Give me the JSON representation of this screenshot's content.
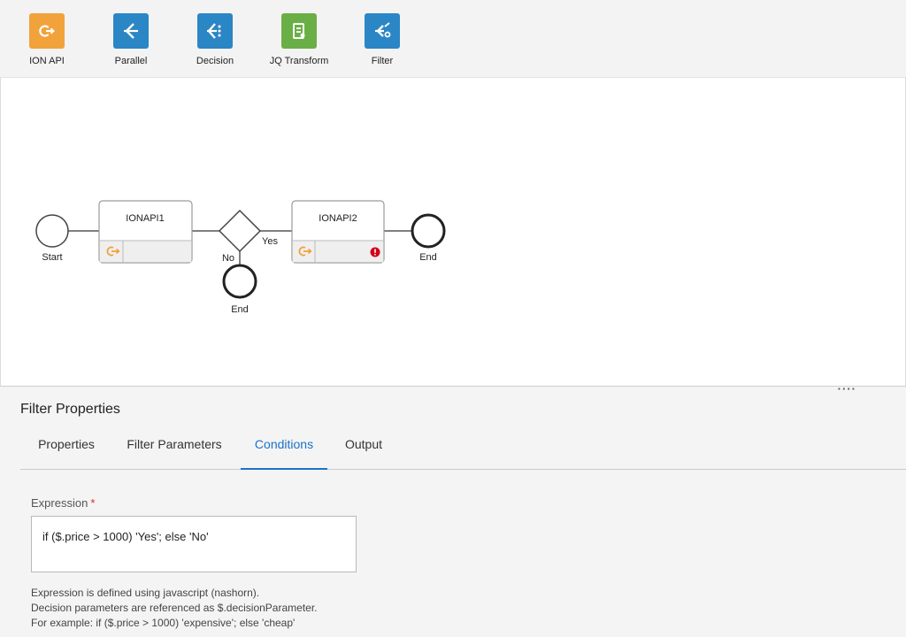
{
  "palette": {
    "items": [
      {
        "label": "ION API",
        "icon": "ion-api-icon",
        "color": "#f2a23a"
      },
      {
        "label": "Parallel",
        "icon": "parallel-icon",
        "color": "#2b86c5"
      },
      {
        "label": "Decision",
        "icon": "decision-icon",
        "color": "#2b86c5"
      },
      {
        "label": "JQ Transform",
        "icon": "jq-transform-icon",
        "color": "#6aaf45"
      },
      {
        "label": "Filter",
        "icon": "filter-icon",
        "color": "#2b86c5"
      }
    ]
  },
  "flow": {
    "start_label": "Start",
    "node1_title": "IONAPI1",
    "node2_title": "IONAPI2",
    "yes_label": "Yes",
    "no_label": "No",
    "end_label_right": "End",
    "end_label_bottom": "End",
    "node2_error_icon": "error-icon",
    "error_color": "#d0021b"
  },
  "properties": {
    "title": "Filter Properties",
    "tabs": [
      {
        "label": "Properties",
        "active": false
      },
      {
        "label": "Filter Parameters",
        "active": false
      },
      {
        "label": "Conditions",
        "active": true
      },
      {
        "label": "Output",
        "active": false
      }
    ],
    "expression_label": "Expression",
    "required_mark": "*",
    "expression_value": "if ($.price > 1000) 'Yes'; else 'No'",
    "help_lines": [
      "Expression is defined using javascript (nashorn).",
      "Decision parameters are referenced as $.decisionParameter.",
      "For example: if ($.price > 1000) 'expensive'; else 'cheap'"
    ],
    "drag_handle": "····"
  },
  "colors": {
    "accent": "#1a73c8"
  }
}
